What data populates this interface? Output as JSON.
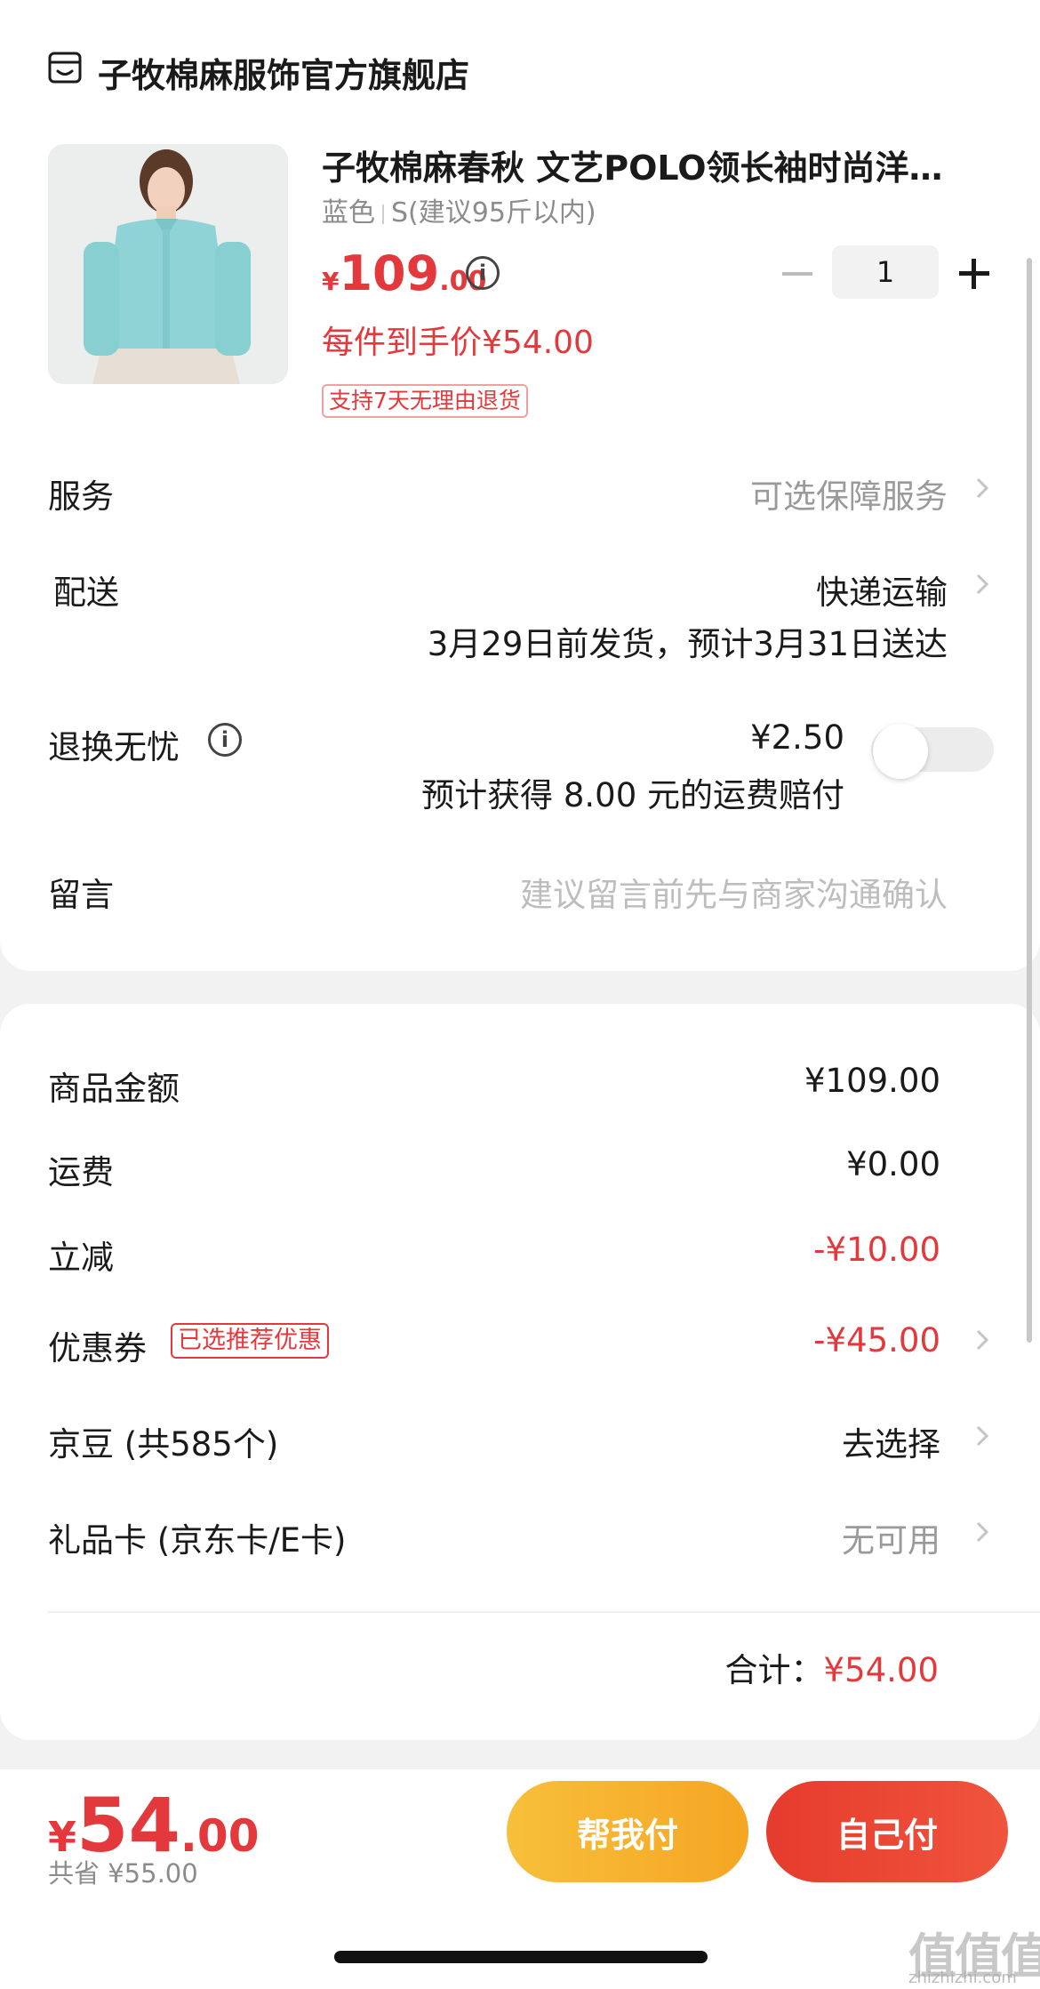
{
  "store": {
    "name": "子牧棉麻服饰官方旗舰店",
    "icon": "store-icon"
  },
  "product": {
    "title": "子牧棉麻春秋 文艺POLO领长袖时尚洋…",
    "color": "蓝色",
    "size": "S(建议95斤以内)",
    "price_currency": "¥",
    "price_int": "109",
    "price_dec": ".00",
    "unit_price": "每件到手价¥54.00",
    "return_badge": "支持7天无理由退货",
    "quantity": "1"
  },
  "rows": {
    "service_label": "服务",
    "service_value": "可选保障服务",
    "delivery_label": "配送",
    "delivery_value": "快递运输",
    "delivery_note": "3月29日前发货，预计3月31日送达",
    "exchange_label": "退换无忧",
    "exchange_price": "¥2.50",
    "exchange_note": "预计获得 8.00 元的运费赔付",
    "exchange_toggle": "off",
    "message_label": "留言",
    "message_placeholder": "建议留言前先与商家沟通确认"
  },
  "summary": {
    "goods_label": "商品金额",
    "goods_value": "¥109.00",
    "shipping_label": "运费",
    "shipping_value": "¥0.00",
    "discount_label": "立减",
    "discount_value": "-¥10.00",
    "coupon_label": "优惠券",
    "coupon_tag": "已选推荐优惠",
    "coupon_value": "-¥45.00",
    "jd_beans_label": "京豆 (共585个)",
    "jd_beans_value": "去选择",
    "gift_card_label": "礼品卡 (京东卡/E卡)",
    "gift_card_value": "无可用",
    "total_label": "合计：",
    "total_value": "¥54.00"
  },
  "footer": {
    "currency": "¥",
    "total_int": "54",
    "total_dec": ".00",
    "saved": "共省 ¥55.00",
    "help_pay": "帮我付",
    "self_pay": "自己付"
  },
  "watermark": {
    "logo": "值值值",
    "url": "zhizhizhi.com"
  },
  "colors": {
    "accent_red": "#e4393c",
    "pay_orange": "#f5a623",
    "pay_red": "#e63b2e"
  }
}
